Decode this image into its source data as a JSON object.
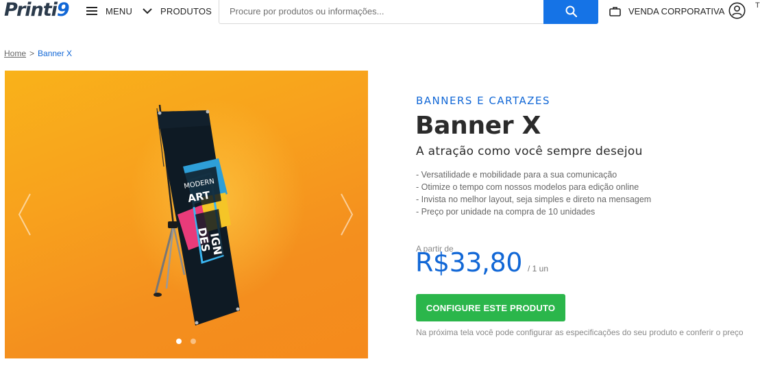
{
  "header": {
    "logo_main": "Printi",
    "logo_tail": "9",
    "menu_label": "MENU",
    "products_label": "PRODUTOS",
    "search_placeholder": "Procure por produtos ou informações...",
    "corporate_label": "VENDA CORPORATIVA",
    "edge_glyph": "T"
  },
  "breadcrumb": {
    "home": "Home",
    "separator": ">",
    "current": "Banner X"
  },
  "gallery": {
    "slides": 2,
    "active_slide": 1,
    "banner_text": [
      "MODERN",
      "ART",
      "DES",
      "IGN"
    ]
  },
  "product": {
    "category": "BANNERS E CARTAZES",
    "title": "Banner X",
    "subtitle": "A atração como você sempre desejou",
    "features": [
      "- Versatilidade e mobilidade para a sua comunicação",
      "- Otimize o tempo com nossos modelos para edição online",
      "- Invista no melhor layout, seja simples e direto na mensagem",
      "- Preço por unidade na compra de 10 unidades"
    ],
    "price_from": "A partir de",
    "price": "R$33,80",
    "price_unit": "/ 1 un",
    "cta_label": "CONFIGURE ESTE PRODUTO",
    "hint": "Na próxima tela você pode configurar as especificações do seu produto e conferir o preço"
  },
  "colors": {
    "brand_blue": "#1167d6",
    "search_button": "#1573e6",
    "cta_green": "#2bb64b",
    "gallery_orange": "#f8a21d"
  },
  "icons": [
    "hamburger-icon",
    "chevron-down-icon",
    "search-icon",
    "briefcase-icon",
    "user-icon",
    "chevron-left-icon",
    "chevron-right-icon"
  ]
}
